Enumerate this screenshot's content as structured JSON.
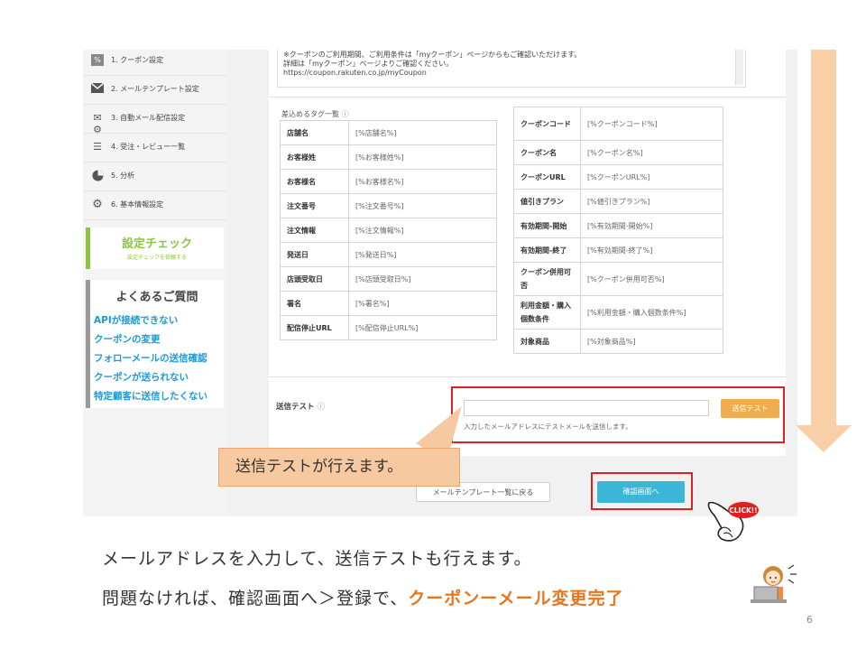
{
  "sidebar": {
    "items": [
      {
        "label": "1. クーポン設定",
        "icon": "coupon-icon"
      },
      {
        "label": "2. メールテンプレート設定",
        "icon": "mail-icon"
      },
      {
        "label": "3. 自動メール配信設定",
        "icon": "auto-mail-gear-icon"
      },
      {
        "label": "4. 受注・レビュー一覧",
        "icon": "list-icon"
      },
      {
        "label": "5. 分析",
        "icon": "pie-chart-icon"
      },
      {
        "label": "6. 基本情報設定",
        "icon": "gear-icon"
      }
    ],
    "check": {
      "title": "設定チェック",
      "sub": "設定チェックを依頼する"
    },
    "faq": {
      "title": "よくあるご質問",
      "links": [
        "APIが接続できない",
        "クーポンの変更",
        "フォローメールの送信確認",
        "クーポンが送られない",
        "特定顧客に送信したくない"
      ]
    }
  },
  "notice": {
    "line1": "※クーポンのご利用期間、ご利用条件は「myクーポン」ページからもご確認いただけます。",
    "line2": "詳細は「myクーポン」ページよりご確認ください。",
    "line3": "https://coupon.rakuten.co.jp/myCoupon"
  },
  "tags": {
    "caption": "差込めるタグ一覧",
    "left": [
      [
        "店舗名",
        "[%店舗名%]"
      ],
      [
        "お客様姓",
        "[%お客様姓%]"
      ],
      [
        "お客様名",
        "[%お客様名%]"
      ],
      [
        "注文番号",
        "[%注文番号%]"
      ],
      [
        "注文情報",
        "[%注文情報%]"
      ],
      [
        "発送日",
        "[%発送日%]"
      ],
      [
        "店頭受取日",
        "[%店頭受取日%]"
      ],
      [
        "署名",
        "[%署名%]"
      ],
      [
        "配信停止URL",
        "[%配信停止URL%]"
      ]
    ],
    "right": [
      [
        "クーポンコード",
        "[%クーポンコード%]"
      ],
      [
        "クーポン名",
        "[%クーポン名%]"
      ],
      [
        "クーポンURL",
        "[%クーポンURL%]"
      ],
      [
        "値引きプラン",
        "[%値引きプラン%]"
      ],
      [
        "有効期間-開始",
        "[%有効期間-開始%]"
      ],
      [
        "有効期間-終了",
        "[%有効期間-終了%]"
      ],
      [
        "クーポン併用可否",
        "[%クーポン併用可否%]"
      ],
      [
        "利用金額・購入個数条件",
        "[%利用金額・購入個数条件%]"
      ],
      [
        "対象商品",
        "[%対象商品%]"
      ]
    ]
  },
  "send_test": {
    "label": "送信テスト",
    "value": "",
    "button": "送信テスト",
    "hint": "入力したメールアドレスにテストメールを送信します。"
  },
  "buttons": {
    "back": "メールテンプレート一覧に戻る",
    "confirm": "確認画面へ"
  },
  "callout": "送信テストが行えます。",
  "click_label": "CLICK!!",
  "caption": {
    "line1": "メールアドレスを入力して、送信テストも行えます。",
    "line2_prefix": "問題なければ、確認画面へ＞登録で、",
    "line2_highlight": "クーポンーメール変更完了"
  },
  "page_number": "6",
  "colors": {
    "accent_green": "#8cc63f",
    "link_blue": "#1a9bd7",
    "send_orange": "#f0ad4e",
    "confirm_blue": "#3cb6d6",
    "highlight_red": "#e02020",
    "caption_orange": "#e6761d"
  }
}
